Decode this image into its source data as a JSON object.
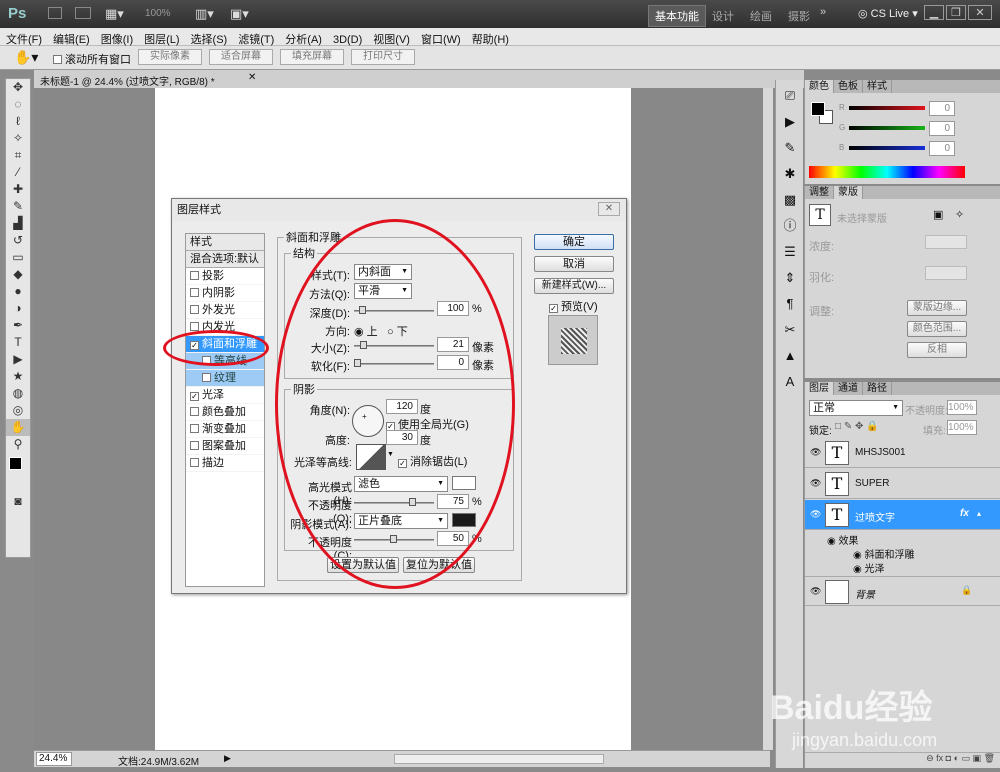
{
  "app": {
    "logo": "Ps",
    "zoom": "100%",
    "workspace_active": "基本功能",
    "workspaces": [
      "设计",
      "绘画",
      "摄影"
    ],
    "cslive": "CS Live"
  },
  "menu": [
    "文件(F)",
    "编辑(E)",
    "图像(I)",
    "图层(L)",
    "选择(S)",
    "滤镜(T)",
    "分析(A)",
    "3D(D)",
    "视图(V)",
    "窗口(W)",
    "帮助(H)"
  ],
  "options": {
    "scroll_all": "滚动所有窗口",
    "actual_pixels": "实际像素",
    "fit_screen": "适合屏幕",
    "fill_screen": "填充屏幕",
    "print_size": "打印尺寸"
  },
  "document": {
    "tab": "未标题-1 @ 24.4% (过喷文字, RGB/8) *",
    "zoom": "24.4%",
    "docinfo": "文档:24.9M/3.62M"
  },
  "dialog": {
    "title": "图层样式",
    "styles_header": "样式",
    "blend_options": "混合选项:默认",
    "style_items": [
      {
        "label": "投影",
        "checked": false
      },
      {
        "label": "内阴影",
        "checked": false
      },
      {
        "label": "外发光",
        "checked": false
      },
      {
        "label": "内发光",
        "checked": false
      },
      {
        "label": "斜面和浮雕",
        "checked": true,
        "selected": true
      },
      {
        "label": "等高线",
        "checked": false,
        "sub": true
      },
      {
        "label": "纹理",
        "checked": false,
        "sub": true
      },
      {
        "label": "光泽",
        "checked": true
      },
      {
        "label": "颜色叠加",
        "checked": false
      },
      {
        "label": "渐变叠加",
        "checked": false
      },
      {
        "label": "图案叠加",
        "checked": false
      },
      {
        "label": "描边",
        "checked": false
      }
    ],
    "section_title": "斜面和浮雕",
    "structure": {
      "legend": "结构",
      "style_label": "样式(T):",
      "style_value": "内斜面",
      "technique_label": "方法(Q):",
      "technique_value": "平滑",
      "depth_label": "深度(D):",
      "depth_value": "100",
      "depth_unit": "%",
      "direction_label": "方向:",
      "dir_up": "上",
      "dir_down": "下",
      "size_label": "大小(Z):",
      "size_value": "21",
      "size_unit": "像素",
      "soften_label": "软化(F):",
      "soften_value": "0",
      "soften_unit": "像素"
    },
    "shading": {
      "legend": "阴影",
      "angle_label": "角度(N):",
      "angle_value": "120",
      "angle_unit": "度",
      "global_light": "使用全局光(G)",
      "altitude_label": "高度:",
      "altitude_value": "30",
      "altitude_unit": "度",
      "gloss_label": "光泽等高线:",
      "antialias": "消除锯齿(L)",
      "hl_mode_label": "高光模式(H):",
      "hl_mode_value": "滤色",
      "hl_opacity_label": "不透明度(O):",
      "hl_opacity_value": "75",
      "hl_color": "#ffffff",
      "sh_mode_label": "阴影模式(A):",
      "sh_mode_value": "正片叠底",
      "sh_opacity_label": "不透明度(C):",
      "sh_opacity_value": "50",
      "sh_color": "#1a1a1a",
      "pct": "%"
    },
    "set_default": "设置为默认值",
    "reset_default": "复位为默认值",
    "ok": "确定",
    "cancel": "取消",
    "new_style": "新建样式(W)...",
    "preview": "预览(V)"
  },
  "color_panel": {
    "tabs": [
      "颜色",
      "色板",
      "样式"
    ],
    "channels": [
      {
        "name": "R",
        "value": "0",
        "color": "#e0141c"
      },
      {
        "name": "G",
        "value": "0",
        "color": "#18b418"
      },
      {
        "name": "B",
        "value": "0",
        "color": "#1830d8"
      }
    ]
  },
  "adjust_panel": {
    "tabs": [
      "调整",
      "蒙版"
    ],
    "no_mask": "未选择蒙版",
    "density": "浓度:",
    "feather": "羽化:",
    "refine": "调整:",
    "mask_edge": "蒙版边缘...",
    "color_range": "颜色范围...",
    "invert": "反相"
  },
  "layers_panel": {
    "tabs": [
      "图层",
      "通道",
      "路径"
    ],
    "blend": "正常",
    "opacity_label": "不透明度:",
    "opacity": "100%",
    "lock_label": "锁定:",
    "fill_label": "填充:",
    "fill": "100%",
    "layers": [
      {
        "name": "MHSJS001",
        "type": "T"
      },
      {
        "name": "SUPER",
        "type": "T"
      },
      {
        "name": "过喷文字",
        "type": "T",
        "selected": true,
        "fx": "fx"
      }
    ],
    "effects_label": "效果",
    "effects": [
      "斜面和浮雕",
      "光泽"
    ],
    "background": "背景"
  },
  "watermark": {
    "brand": "Baidu经验",
    "url": "jingyan.baidu.com"
  }
}
